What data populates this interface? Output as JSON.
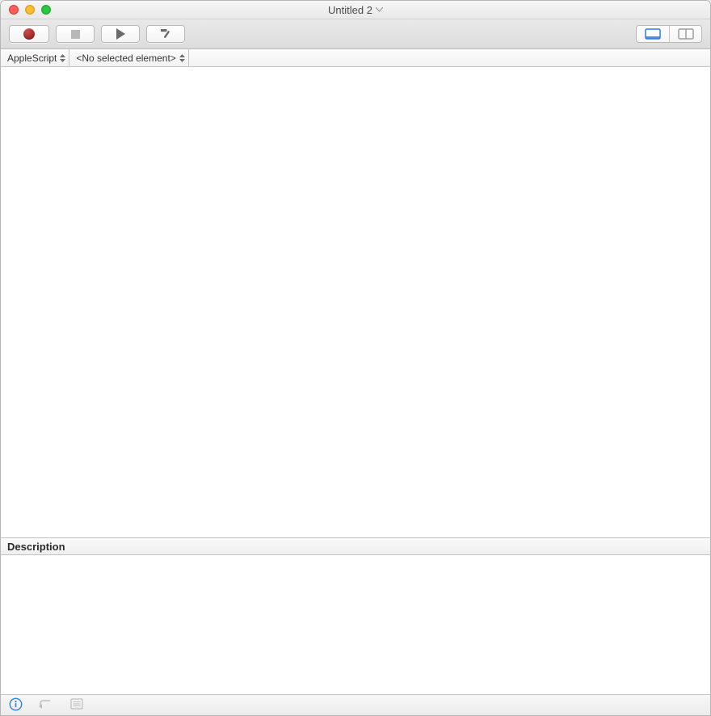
{
  "window": {
    "title": "Untitled 2"
  },
  "toolbar": {
    "view_mode": "full"
  },
  "navbar": {
    "language_label": "AppleScript",
    "element_label": "<No selected element>"
  },
  "description": {
    "header": "Description"
  },
  "icons": {
    "record": "record-icon",
    "stop": "stop-icon",
    "run": "run-icon",
    "compile": "compile-icon",
    "view_full": "view-full-icon",
    "view_split": "view-split-icon",
    "info": "info-icon",
    "reply": "reply-arrow-icon",
    "list": "list-icon",
    "title_chevron": "chevron-down-icon",
    "sort": "sort-arrows-icon"
  }
}
